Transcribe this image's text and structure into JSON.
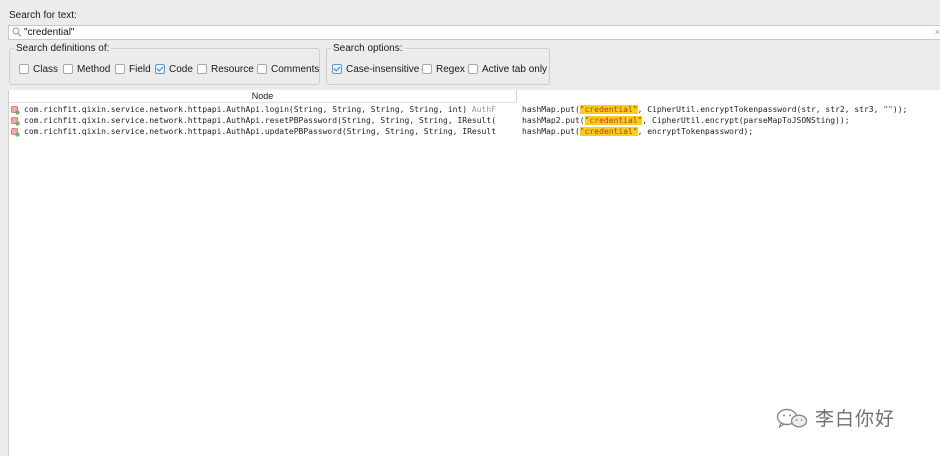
{
  "search": {
    "label": "Search for text:",
    "value": "\"credential\"",
    "clear": "×"
  },
  "definitions": {
    "legend": "Search definitions of:",
    "items": [
      {
        "label": "Class",
        "checked": false
      },
      {
        "label": "Method",
        "checked": false
      },
      {
        "label": "Field",
        "checked": false
      },
      {
        "label": "Code",
        "checked": true
      },
      {
        "label": "Resource",
        "checked": false
      },
      {
        "label": "Comments",
        "checked": false
      }
    ]
  },
  "options": {
    "legend": "Search options:",
    "items": [
      {
        "label": "Case-insensitive",
        "checked": true
      },
      {
        "label": "Regex",
        "checked": false
      },
      {
        "label": "Active tab only",
        "checked": false
      }
    ]
  },
  "results": {
    "header": "Node",
    "rows": [
      {
        "node": "com.richfit.qixin.service.network.httpapi.AuthApi.login(String, String, String, String, int)",
        "node_extra": " AuthF",
        "code_pre": "hashMap.put(",
        "code_hl": "\"credential\"",
        "code_mid": ", CipherUtil.encryptTokenpassword(str, str2, str3, ",
        "code_str": "\"\"",
        "code_post": "));"
      },
      {
        "node": "com.richfit.qixin.service.network.httpapi.AuthApi.resetPBPassword(String, String, String, IResult(",
        "node_extra": "",
        "code_pre": "hashMap2.put(",
        "code_hl": "\"credential\"",
        "code_mid": ", CipherUtil.encrypt(parseMapToJSONSting));",
        "code_str": "",
        "code_post": ""
      },
      {
        "node": "com.richfit.qixin.service.network.httpapi.AuthApi.updatePBPassword(String, String, String, IResult",
        "node_extra": "",
        "code_pre": "hashMap.put(",
        "code_hl": "\"credential\"",
        "code_mid": ", encryptTokenpassword);",
        "code_str": "",
        "code_post": ""
      }
    ]
  },
  "watermark": {
    "text": "李白你好",
    "icon": "wechat-icon"
  },
  "colors": {
    "highlight": "#f6cf1c",
    "string": "#c7361d",
    "check_accent": "#3a78c2"
  }
}
